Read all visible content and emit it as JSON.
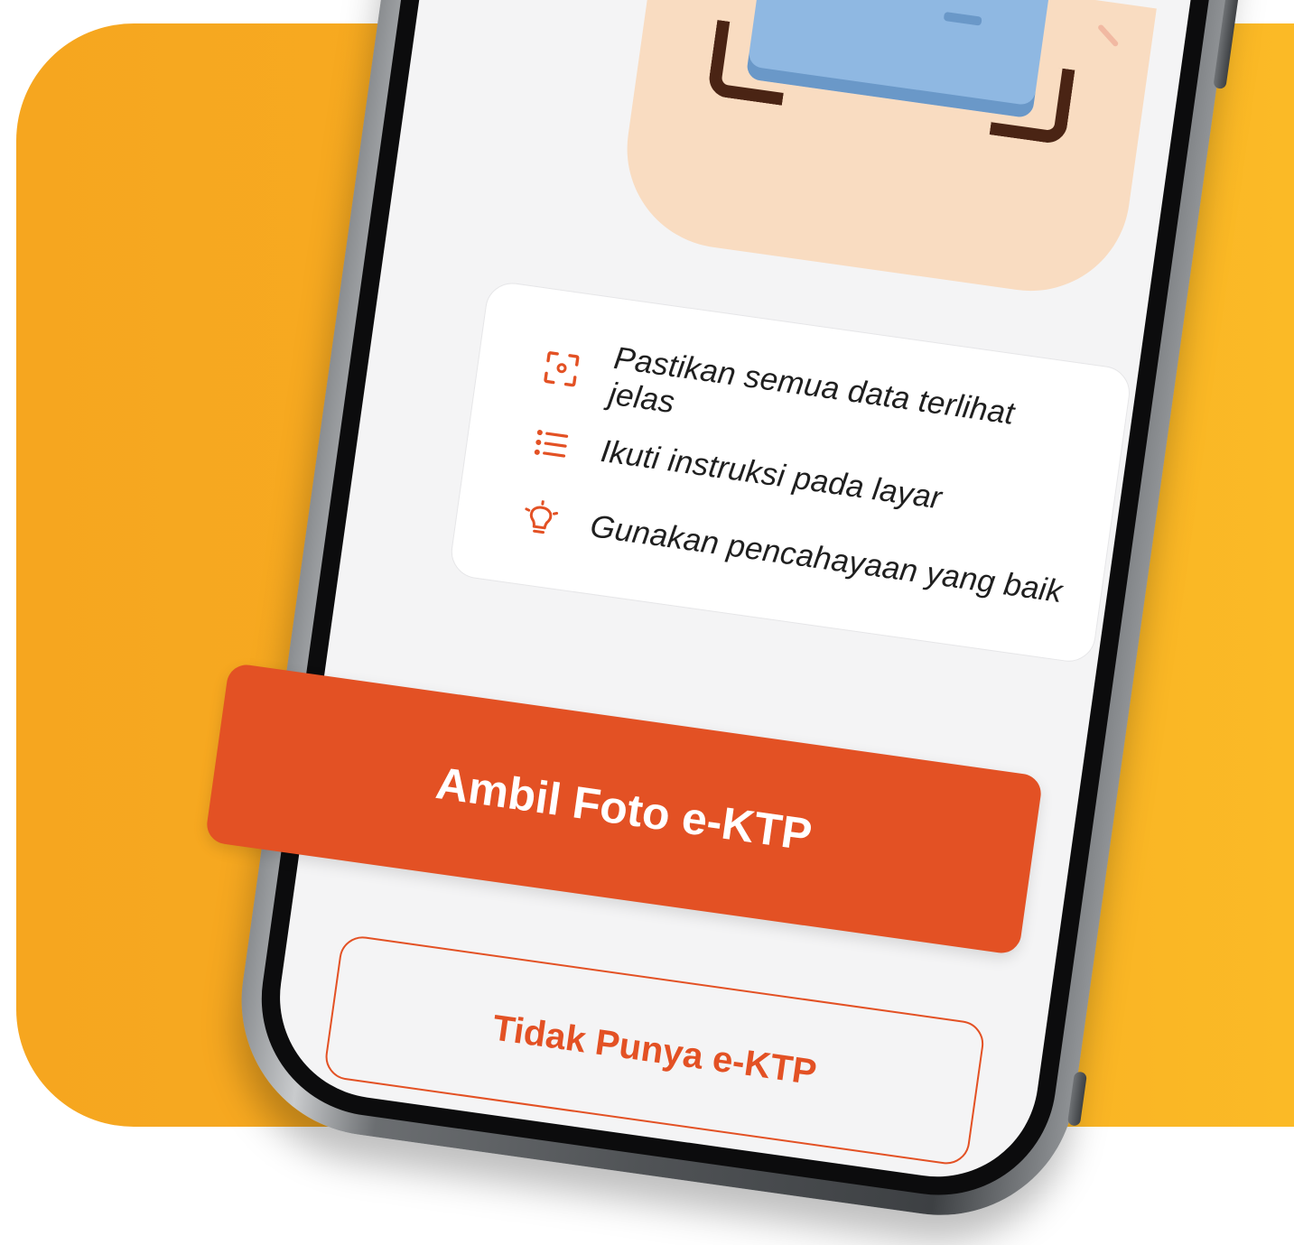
{
  "tips": [
    {
      "icon": "scan-focus-icon",
      "label": "Pastikan semua data terlihat jelas"
    },
    {
      "icon": "list-icon",
      "label": "Ikuti instruksi pada layar"
    },
    {
      "icon": "lightbulb-icon",
      "label": "Gunakan pencahayaan yang baik"
    }
  ],
  "buttons": {
    "primary_label": "Ambil Foto e-KTP",
    "secondary_label": "Tidak Punya e-KTP"
  },
  "colors": {
    "accent": "#e35124",
    "background_orange": "#f8ae22"
  }
}
